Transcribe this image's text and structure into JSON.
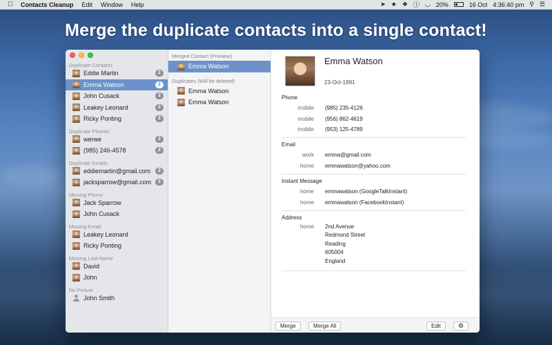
{
  "menubar": {
    "app_name": "Contacts Cleanup",
    "menus": [
      "Edit",
      "Window",
      "Help"
    ],
    "battery": "20%",
    "date": "16 Oct",
    "time": "4:36:40 pm"
  },
  "headline": "Merge the duplicate contacts into a single contact!",
  "sidebar": {
    "sections": [
      {
        "title": "Duplicate Contacts",
        "items": [
          {
            "label": "Eddie Martin",
            "count": "2"
          },
          {
            "label": "Emma Watson",
            "count": "2",
            "selected": true
          },
          {
            "label": "John Cusack",
            "count": "2"
          },
          {
            "label": "Leakey Leonard",
            "count": "2"
          },
          {
            "label": "Ricky Ponting",
            "count": "2"
          }
        ]
      },
      {
        "title": "Duplicate Phones",
        "items": [
          {
            "label": "werwe",
            "count": "2"
          },
          {
            "label": "(985) 246-4578",
            "count": "2"
          }
        ]
      },
      {
        "title": "Duplicate Emails",
        "items": [
          {
            "label": "eddiemartin@gmail.com",
            "count": "2"
          },
          {
            "label": "jacksparrow@gmail.com",
            "count": "2"
          }
        ]
      },
      {
        "title": "Missing Phone",
        "items": [
          {
            "label": "Jack Sparrow"
          },
          {
            "label": "John Cusack"
          }
        ]
      },
      {
        "title": "Missing Email",
        "items": [
          {
            "label": "Leakey Leonard"
          },
          {
            "label": "Ricky Ponting"
          }
        ]
      },
      {
        "title": "Missing Last Name",
        "items": [
          {
            "label": "David"
          },
          {
            "label": "John"
          }
        ]
      },
      {
        "title": "No Picture",
        "items": [
          {
            "label": "John Smith",
            "placeholder": true
          }
        ]
      }
    ]
  },
  "middle": {
    "merged_title": "Merged Contact (Preview)",
    "merged_item": "Emma Watson",
    "duplicates_title": "Duplicates (Will be deleted)",
    "duplicates": [
      "Emma Watson",
      "Emma Watson"
    ]
  },
  "detail": {
    "name": "Emma Watson",
    "date": "23-Oct-1991",
    "phone": {
      "title": "Phone",
      "fields": [
        {
          "label": "mobile",
          "value": "(985) 235-4126"
        },
        {
          "label": "mobile",
          "value": "(956) 862-4619"
        },
        {
          "label": "mobile",
          "value": "(953) 125-4789"
        }
      ]
    },
    "email": {
      "title": "Email",
      "fields": [
        {
          "label": "work",
          "value": "emma@gmail.com"
        },
        {
          "label": "home",
          "value": "emmawatson@yahoo.com"
        }
      ]
    },
    "im": {
      "title": "Instant Message",
      "fields": [
        {
          "label": "home",
          "value": "emmawatson (GoogleTalkInstant)"
        },
        {
          "label": "home",
          "value": "emmawatson (FacebookInstant)"
        }
      ]
    },
    "address": {
      "title": "Address",
      "label": "home",
      "lines": [
        "2nd Avenue",
        "Redmond Street",
        "Reading",
        "605004",
        "England"
      ]
    }
  },
  "buttons": {
    "merge": "Merge",
    "merge_all": "Merge All",
    "edit": "Edit",
    "settings_icon": "gear-icon"
  }
}
